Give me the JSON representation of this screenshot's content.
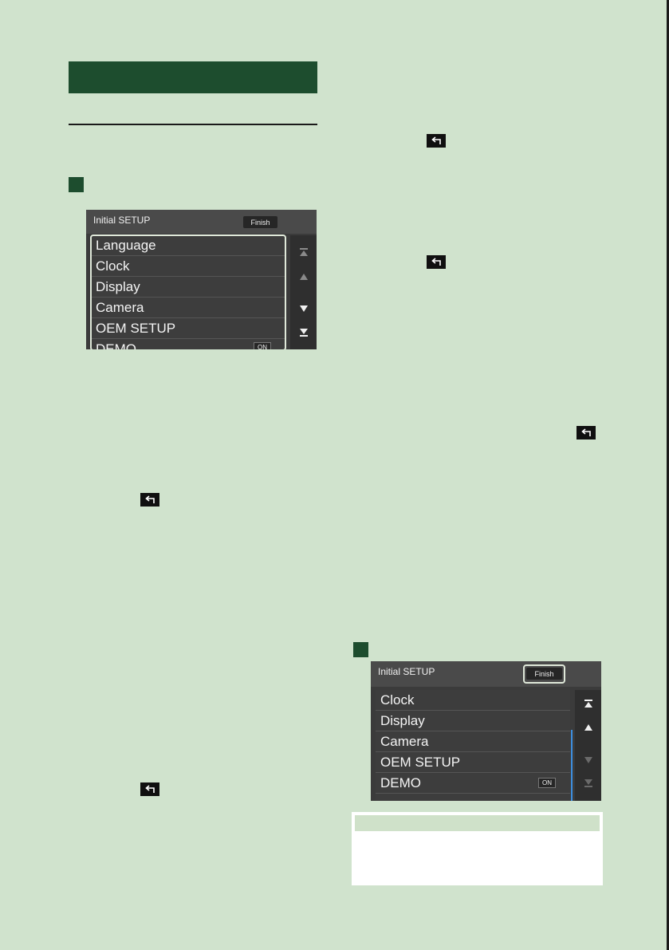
{
  "screen1": {
    "title": "Initial SETUP",
    "finish_label": "Finish",
    "items": [
      {
        "label": "Language"
      },
      {
        "label": "Clock"
      },
      {
        "label": "Display"
      },
      {
        "label": "Camera"
      },
      {
        "label": "OEM SETUP"
      },
      {
        "label": "DEMO",
        "value": "ON"
      }
    ]
  },
  "screen2": {
    "title": "Initial SETUP",
    "finish_label": "Finish",
    "items": [
      {
        "label": "Clock"
      },
      {
        "label": "Display"
      },
      {
        "label": "Camera"
      },
      {
        "label": "OEM SETUP"
      },
      {
        "label": "DEMO",
        "value": "ON"
      }
    ]
  },
  "icons": [
    "back-arrow-icon",
    "scroll-top-icon",
    "scroll-up-icon",
    "scroll-down-icon",
    "scroll-bottom-icon"
  ],
  "colors": {
    "page_bg": "#d0e3cd",
    "header_bar": "#1d4d2e",
    "highlight": "#dfe8d9",
    "scroll_indicator": "#3d8fe0"
  }
}
